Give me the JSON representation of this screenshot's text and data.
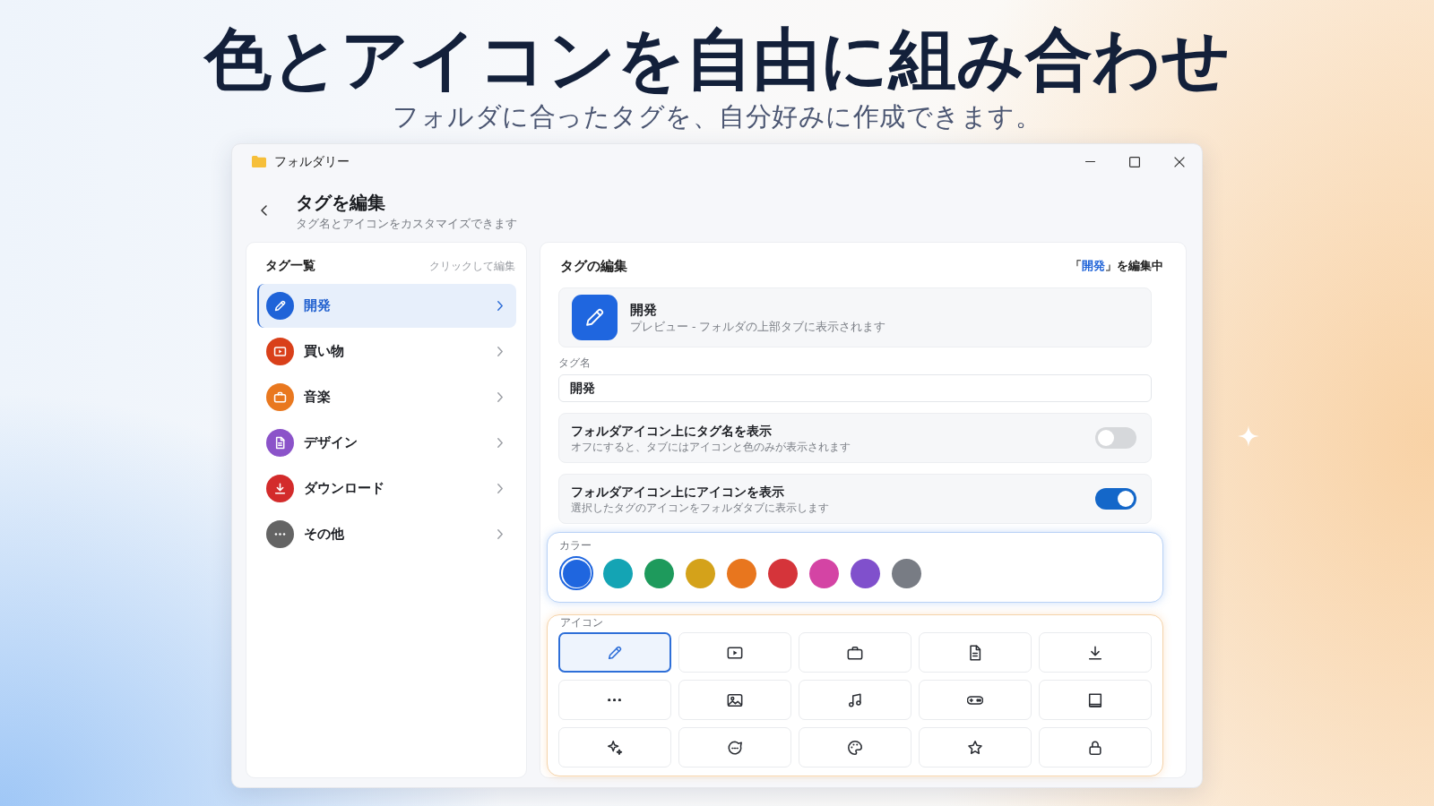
{
  "promo": {
    "headline": "色とアイコンを自由に組み合わせ",
    "subtitle": "フォルダに合ったタグを、自分好みに作成できます。"
  },
  "window": {
    "title": "フォルダリー"
  },
  "header": {
    "title": "タグを編集",
    "subtitle": "タグ名とアイコンをカスタマイズできます"
  },
  "tag_list": {
    "title": "タグ一覧",
    "hint": "クリックして編集",
    "items": [
      {
        "label": "開発",
        "color": "#1f63d8",
        "selected": true
      },
      {
        "label": "買い物",
        "color": "#d9401a",
        "selected": false
      },
      {
        "label": "音楽",
        "color": "#e9781f",
        "selected": false
      },
      {
        "label": "デザイン",
        "color": "#8b53c9",
        "selected": false
      },
      {
        "label": "ダウンロード",
        "color": "#d32b2b",
        "selected": false
      },
      {
        "label": "その他",
        "color": "#646464",
        "selected": false
      }
    ]
  },
  "editor": {
    "title": "タグの編集",
    "status": {
      "before": "「",
      "name": "開発",
      "after": "」を編集中"
    },
    "preview": {
      "name": "開発",
      "caption": "プレビュー - フォルダの上部タブに表示されます"
    },
    "tag_name": {
      "label": "タグ名",
      "value": "開発"
    },
    "options": [
      {
        "title": "フォルダアイコン上にタグ名を表示",
        "description": "オフにすると、タブにはアイコンと色のみが表示されます",
        "on": false
      },
      {
        "title": "フォルダアイコン上にアイコンを表示",
        "description": "選択したタグのアイコンをフォルダタブに表示します",
        "on": true
      }
    ],
    "colors": {
      "label": "カラー",
      "swatches": [
        {
          "color": "#1f66df",
          "selected": true
        },
        {
          "color": "#14a4b4",
          "selected": false
        },
        {
          "color": "#1e9a5c",
          "selected": false
        },
        {
          "color": "#d4a21a",
          "selected": false
        },
        {
          "color": "#e8761e",
          "selected": false
        },
        {
          "color": "#d5343a",
          "selected": false
        },
        {
          "color": "#d444a4",
          "selected": false
        },
        {
          "color": "#8050cc",
          "selected": false
        },
        {
          "color": "#787c84",
          "selected": false
        }
      ]
    },
    "icons": {
      "label": "アイコン",
      "items": [
        {
          "selected": true
        },
        {
          "selected": false
        },
        {
          "selected": false
        },
        {
          "selected": false
        },
        {
          "selected": false
        },
        {
          "selected": false
        },
        {
          "selected": false
        },
        {
          "selected": false
        },
        {
          "selected": false
        },
        {
          "selected": false
        },
        {
          "selected": false
        },
        {
          "selected": false
        },
        {
          "selected": false
        },
        {
          "selected": false
        },
        {
          "selected": false
        }
      ]
    }
  }
}
